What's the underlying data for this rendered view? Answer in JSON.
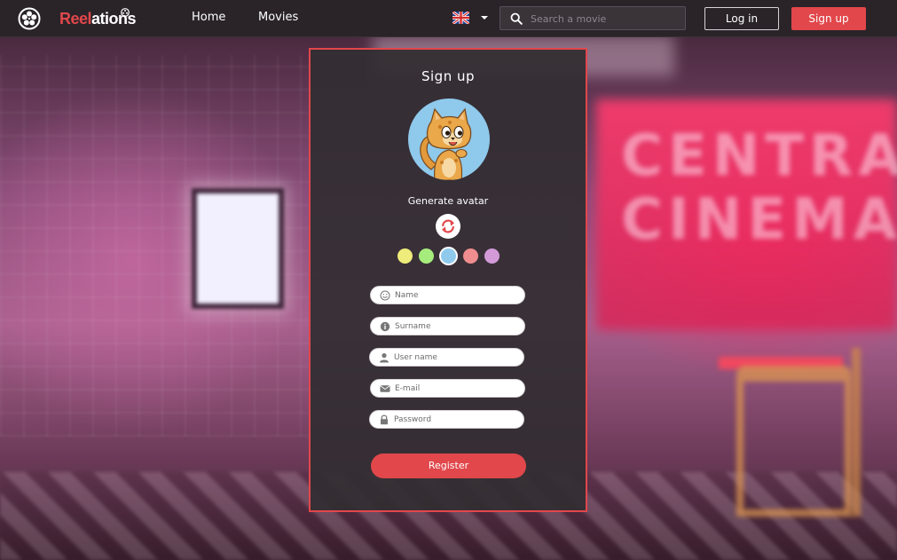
{
  "app": {
    "brand_part1": "Reel",
    "brand_part2": "ations"
  },
  "nav": {
    "links": [
      "Home",
      "Movies"
    ],
    "language_flag": "uk-flag-icon",
    "search_placeholder": "Search a movie",
    "search_value": "",
    "login_label": "Log in",
    "signup_label": "Sign up"
  },
  "signup": {
    "title": "Sign up",
    "avatar_label": "Generate avatar",
    "avatar_colors": [
      "#eeec7a",
      "#a6ec7d",
      "#8fc9ec",
      "#f08d8f",
      "#d49ad8"
    ],
    "selected_color": "#8fc9ec",
    "fields": [
      {
        "icon": "smiley-icon",
        "placeholder": "Name",
        "value": ""
      },
      {
        "icon": "info-icon",
        "placeholder": "Surname",
        "value": ""
      },
      {
        "icon": "user-icon",
        "placeholder": "User name",
        "value": ""
      },
      {
        "icon": "envelope-icon",
        "placeholder": "E-mail",
        "value": ""
      },
      {
        "icon": "lock-icon",
        "placeholder": "Password",
        "value": ""
      }
    ],
    "register_label": "Register"
  },
  "colors": {
    "accent": "#e1474b",
    "navbar": "#2a2429",
    "panel": "#322d31"
  },
  "background": {
    "sign_text": "CENTRAL CINEMA"
  }
}
